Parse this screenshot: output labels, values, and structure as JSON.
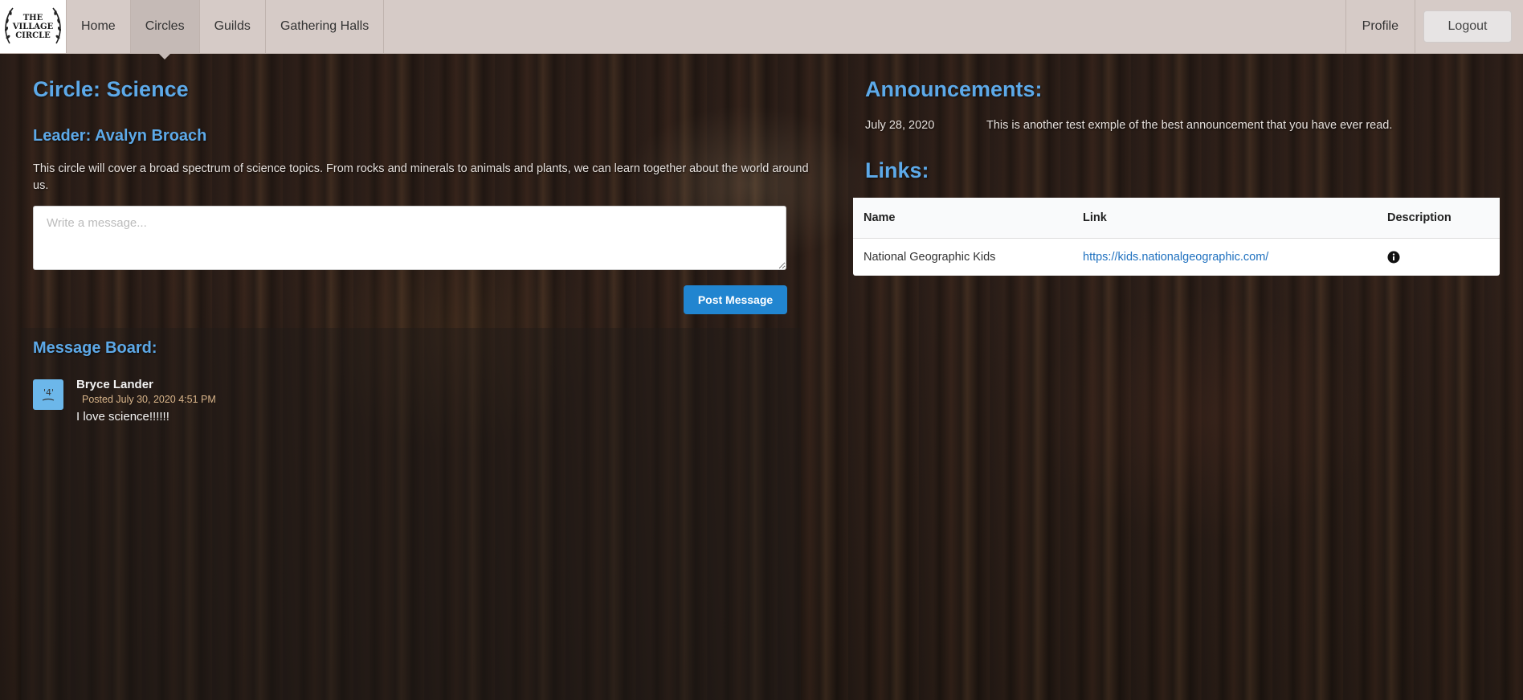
{
  "nav": {
    "logo_text": "THE\nVILLAGE\nCIRCLE",
    "items": [
      {
        "label": "Home"
      },
      {
        "label": "Circles",
        "active": true
      },
      {
        "label": "Guilds"
      },
      {
        "label": "Gathering Halls"
      }
    ],
    "profile_label": "Profile",
    "logout_label": "Logout"
  },
  "circle": {
    "title": "Circle: Science",
    "leader": "Leader: Avalyn Broach",
    "description": "This circle will cover a broad spectrum of science topics. From rocks and minerals to animals and plants, we can learn together about the world around us."
  },
  "composer": {
    "placeholder": "Write a message...",
    "post_label": "Post Message"
  },
  "board": {
    "title": "Message Board:",
    "posts": [
      {
        "author": "Bryce Lander",
        "date": "Posted July 30, 2020 4:51 PM",
        "text": "I love science!!!!!!"
      }
    ]
  },
  "announcements": {
    "title": "Announcements:",
    "items": [
      {
        "date": "July 28, 2020",
        "text": "This is another test exmple of the best announcement that you have ever read."
      }
    ]
  },
  "links": {
    "title": "Links:",
    "headers": [
      "Name",
      "Link",
      "Description"
    ],
    "rows": [
      {
        "name": "National Geographic Kids",
        "url": "https://kids.nationalgeographic.com/",
        "description_icon": "info-circle-icon"
      }
    ]
  },
  "colors": {
    "accent": "#5da9e8",
    "button_blue": "#2185d0",
    "navbar": "#d6cbc7",
    "date_text": "#d9b58a"
  }
}
